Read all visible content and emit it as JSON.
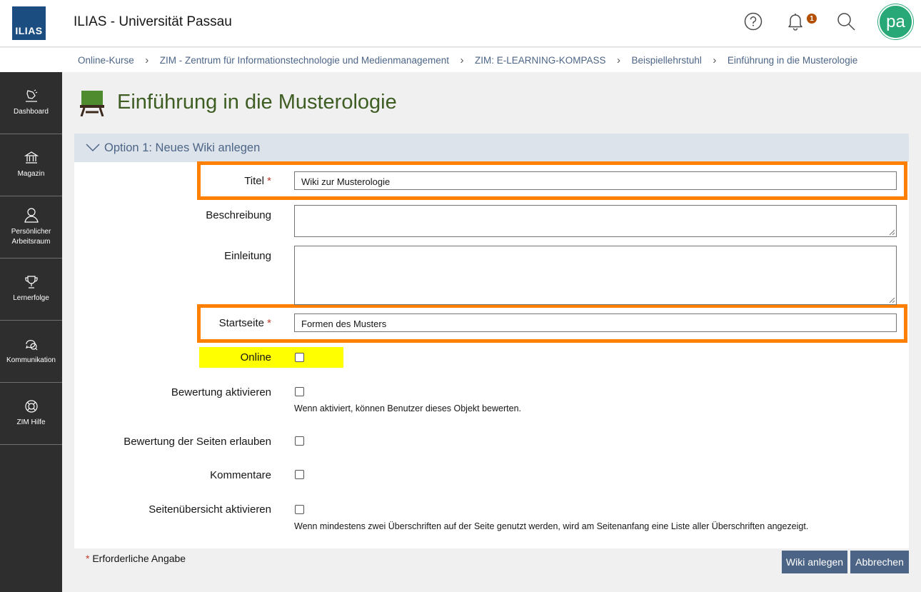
{
  "header": {
    "logo_text": "ILIAS",
    "title": "ILIAS - Universität Passau",
    "notification_count": "1",
    "avatar_initials": "pa"
  },
  "breadcrumb": [
    "Online-Kurse",
    "ZIM - Zentrum für Informationstechnologie und Medienmanagement",
    "ZIM: E-LEARNING-KOMPASS",
    "Beispiellehrstuhl",
    "Einführung in die Musterologie"
  ],
  "sidebar": {
    "items": [
      {
        "label": "Dashboard",
        "icon": "dashboard-icon"
      },
      {
        "label": "Magazin",
        "icon": "repository-icon"
      },
      {
        "label": "Persönlicher Arbeitsraum",
        "icon": "person-icon"
      },
      {
        "label": "Lernerfolge",
        "icon": "trophy-icon"
      },
      {
        "label": "Kommunikation",
        "icon": "chat-icon"
      },
      {
        "label": "ZIM Hilfe",
        "icon": "lifebuoy-icon"
      }
    ]
  },
  "page": {
    "title": "Einführung in die Musterologie"
  },
  "form": {
    "section_title": "Option 1: Neues Wiki anlegen",
    "title_label": "Titel",
    "title_value": "Wiki zur Musterologie",
    "description_label": "Beschreibung",
    "description_value": "",
    "intro_label": "Einleitung",
    "intro_value": "",
    "startpage_label": "Startseite",
    "startpage_value": "Formen des Musters",
    "online_label": "Online",
    "online_checked": false,
    "rating_label": "Bewertung aktivieren",
    "rating_checked": false,
    "rating_help": "Wenn aktiviert, können Benutzer dieses Objekt bewerten.",
    "page_rating_label": "Bewertung der Seiten erlauben",
    "page_rating_checked": false,
    "comments_label": "Kommentare",
    "comments_checked": false,
    "toc_label": "Seitenübersicht aktivieren",
    "toc_checked": false,
    "toc_help": "Wenn mindestens zwei Überschriften auf der Seite genutzt werden, wird am Seitenanfang eine Liste aller Überschriften angezeigt.",
    "required_marker": "*",
    "required_note": "Erforderliche Angabe",
    "submit_label": "Wiki anlegen",
    "cancel_label": "Abbrechen"
  },
  "colors": {
    "highlight_orange": "#ff8000",
    "highlight_yellow": "#ffff00",
    "title_green": "#3e5d22",
    "accent_blue": "#4c6586"
  }
}
